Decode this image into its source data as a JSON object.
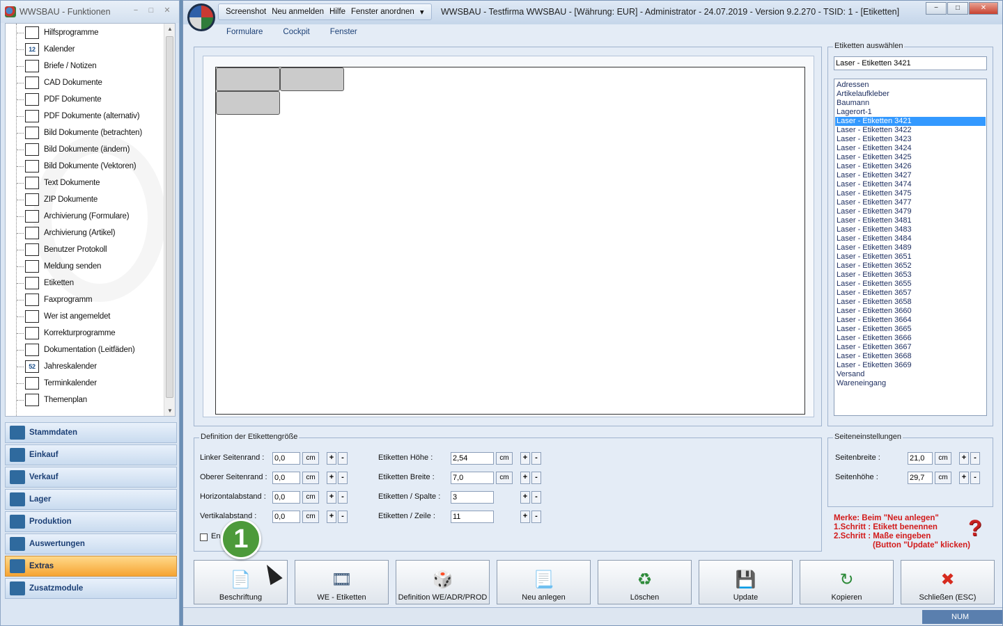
{
  "left_window": {
    "title": "WWSBAU - Funktionen",
    "tree_items": [
      {
        "label": "Hilfsprogramme",
        "icon": "plus-icon"
      },
      {
        "label": "Kalender",
        "icon": "calendar-icon"
      },
      {
        "label": "Briefe / Notizen",
        "icon": "envelope-icon"
      },
      {
        "label": "CAD Dokumente",
        "icon": "cad-icon"
      },
      {
        "label": "PDF Dokumente",
        "icon": "document-icon"
      },
      {
        "label": "PDF Dokumente (alternativ)",
        "icon": "document-icon"
      },
      {
        "label": "Bild Dokumente (betrachten)",
        "icon": "image-icon"
      },
      {
        "label": "Bild Dokumente (ändern)",
        "icon": "image-icon"
      },
      {
        "label": "Bild Dokumente (Vektoren)",
        "icon": "image-icon"
      },
      {
        "label": "Text Dokumente",
        "icon": "text-document-icon"
      },
      {
        "label": "ZIP Dokumente",
        "icon": "zip-icon"
      },
      {
        "label": "Archivierung (Formulare)",
        "icon": "archive-icon"
      },
      {
        "label": "Archivierung (Artikel)",
        "icon": "archive-icon"
      },
      {
        "label": "Benutzer Protokoll",
        "icon": "users-icon"
      },
      {
        "label": "Meldung senden",
        "icon": "send-message-icon"
      },
      {
        "label": "Etiketten",
        "icon": "label-icon"
      },
      {
        "label": "Faxprogramm",
        "icon": "fax-icon"
      },
      {
        "label": "Wer ist angemeldet",
        "icon": "user-globe-icon"
      },
      {
        "label": "Korrekturprogramme",
        "icon": "tools-icon"
      },
      {
        "label": "Dokumentation (Leitfäden)",
        "icon": "signpost-icon"
      },
      {
        "label": "Jahreskalender",
        "icon": "calendar-52-icon"
      },
      {
        "label": "Terminkalender",
        "icon": "bookmark-icon"
      },
      {
        "label": "Themenplan",
        "icon": "presentation-icon"
      }
    ],
    "tree_calendar_day": "12",
    "tree_week": "52",
    "nav_items": [
      {
        "label": "Stammdaten",
        "icon": "master-data-icon"
      },
      {
        "label": "Einkauf",
        "icon": "shopping-cart-icon"
      },
      {
        "label": "Verkauf",
        "icon": "cash-register-icon"
      },
      {
        "label": "Lager",
        "icon": "warehouse-icon"
      },
      {
        "label": "Produktion",
        "icon": "production-icon"
      },
      {
        "label": "Auswertungen",
        "icon": "analytics-icon"
      },
      {
        "label": "Extras",
        "icon": "extras-icon"
      },
      {
        "label": "Zusatzmodule",
        "icon": "modules-icon"
      }
    ],
    "active_nav": "Extras"
  },
  "main_window": {
    "quick_bar": [
      "Screenshot",
      "Neu anmelden",
      "Hilfe",
      "Fenster anordnen"
    ],
    "title": "WWSBAU - Testfirma WWSBAU - [Währung: EUR] - Administrator - 24.07.2019 - Version 9.2.270 - TSID: 1 - [Etiketten]",
    "menu": [
      "Formulare",
      "Cockpit",
      "Fenster"
    ]
  },
  "selection": {
    "group_title": "Etiketten auswählen",
    "current": "Laser - Etiketten 3421",
    "items": [
      "Adressen",
      "Artikelaufkleber",
      "Baumann",
      "Lagerort-1",
      "Laser - Etiketten 3421",
      "Laser - Etiketten 3422",
      "Laser - Etiketten 3423",
      "Laser - Etiketten 3424",
      "Laser - Etiketten 3425",
      "Laser - Etiketten 3426",
      "Laser - Etiketten 3427",
      "Laser - Etiketten 3474",
      "Laser - Etiketten 3475",
      "Laser - Etiketten 3477",
      "Laser - Etiketten 3479",
      "Laser - Etiketten 3481",
      "Laser - Etiketten 3483",
      "Laser - Etiketten 3484",
      "Laser - Etiketten 3489",
      "Laser - Etiketten 3651",
      "Laser - Etiketten 3652",
      "Laser - Etiketten 3653",
      "Laser - Etiketten 3655",
      "Laser - Etiketten 3657",
      "Laser - Etiketten 3658",
      "Laser - Etiketten 3660",
      "Laser - Etiketten 3664",
      "Laser - Etiketten 3665",
      "Laser - Etiketten 3666",
      "Laser - Etiketten 3667",
      "Laser - Etiketten 3668",
      "Laser - Etiketten 3669",
      "Versand",
      "Wareneingang"
    ],
    "selected_index": 4
  },
  "definition": {
    "group_title": "Definition der Etikettengröße",
    "left_fields": [
      {
        "label": "Linker Seitenrand :",
        "value": "0,0",
        "unit": "cm"
      },
      {
        "label": "Oberer Seitenrand :",
        "value": "0,0",
        "unit": "cm"
      },
      {
        "label": "Horizontalabstand :",
        "value": "0,0",
        "unit": "cm"
      },
      {
        "label": "Vertikalabstand :",
        "value": "0,0",
        "unit": "cm"
      }
    ],
    "right_fields": [
      {
        "label": "Etiketten Höhe :",
        "value": "2,54",
        "unit": "cm"
      },
      {
        "label": "Etiketten Breite :",
        "value": "7,0",
        "unit": "cm"
      },
      {
        "label": "Etiketten / Spalte :",
        "value": "3",
        "unit": ""
      },
      {
        "label": "Etiketten / Zeile :",
        "value": "11",
        "unit": ""
      }
    ],
    "checkbox_label": "En"
  },
  "page_settings": {
    "group_title": "Seiteneinstellungen",
    "fields": [
      {
        "label": "Seitenbreite :",
        "value": "21,0",
        "unit": "cm"
      },
      {
        "label": "Seitenhöhe :",
        "value": "29,7",
        "unit": "cm"
      }
    ]
  },
  "hints": [
    "Merke:  Beim \"Neu anlegen\"",
    "1.Schritt : Etikett benennen",
    "2.Schritt : Maße eingeben",
    "(Button \"Update\" klicken)"
  ],
  "help_symbol": "?",
  "plus": "+",
  "minus": "-",
  "actions": [
    {
      "label": "Beschriftung",
      "icon": "document-icon"
    },
    {
      "label": "WE - Etiketten",
      "icon": "film-icon"
    },
    {
      "label": "Definition WE/ADR/PROD",
      "icon": "dice-icon"
    },
    {
      "label": "Neu anlegen",
      "icon": "new-document-icon"
    },
    {
      "label": "Löschen",
      "icon": "recycle-bin-icon"
    },
    {
      "label": "Update",
      "icon": "save-icon"
    },
    {
      "label": "Kopieren",
      "icon": "copy-icon"
    },
    {
      "label": "Schließen (ESC)",
      "icon": "close-icon"
    }
  ],
  "status": {
    "num": "NUM"
  },
  "step_badge": "1"
}
